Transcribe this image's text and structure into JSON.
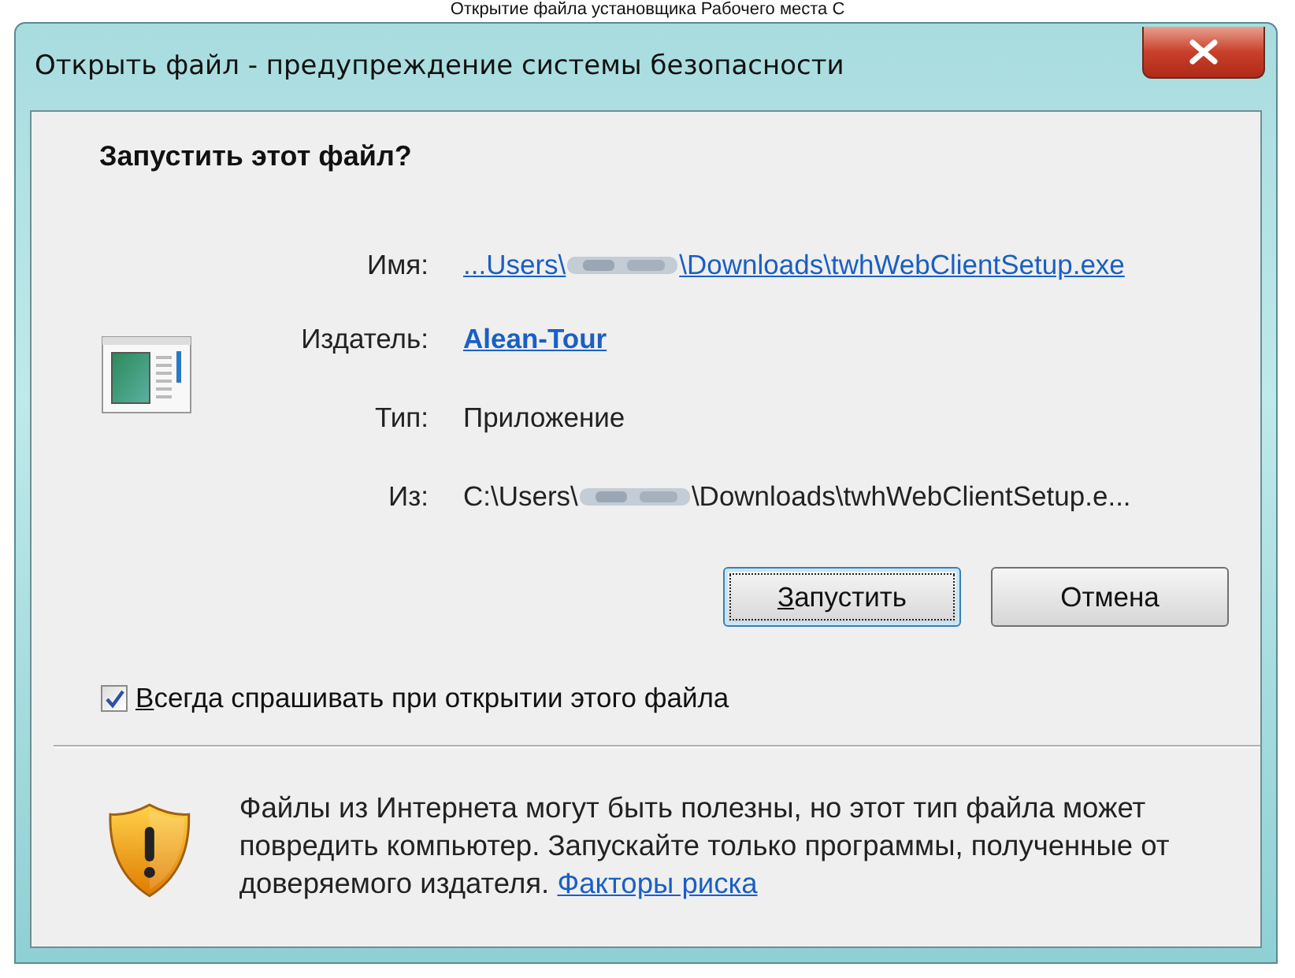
{
  "caption": "Открытие файла установщика Рабочего места С",
  "window": {
    "title": "Открыть файл - предупреждение системы безопасности"
  },
  "heading": "Запустить этот файл?",
  "fields": [
    {
      "label": "Имя:",
      "kind": "link",
      "prefix": "...Users\\",
      "suffix": "\\Downloads\\twhWebClientSetup.exe",
      "bold": false
    },
    {
      "label": "Издатель:",
      "kind": "link",
      "value": "Alean-Tour",
      "bold": true
    },
    {
      "label": "Тип:",
      "kind": "text",
      "value": "Приложение",
      "bold": false
    },
    {
      "label": "Из:",
      "kind": "text",
      "prefix": "C:\\Users\\",
      "suffix": "\\Downloads\\twhWebClientSetup.e...",
      "bold": false
    }
  ],
  "buttons": [
    {
      "label": "Запустить",
      "focused": true,
      "mnemonic": true
    },
    {
      "label": "Отмена",
      "focused": false,
      "mnemonic": false
    }
  ],
  "checkbox": {
    "label": "Всегда спрашивать при открытии этого файла",
    "checked": true
  },
  "warning": {
    "text": "Файлы из Интернета могут быть полезны, но этот тип файла может повредить компьютер. Запускайте только программы, полученные от доверяемого издателя.",
    "link": "Факторы риска"
  }
}
